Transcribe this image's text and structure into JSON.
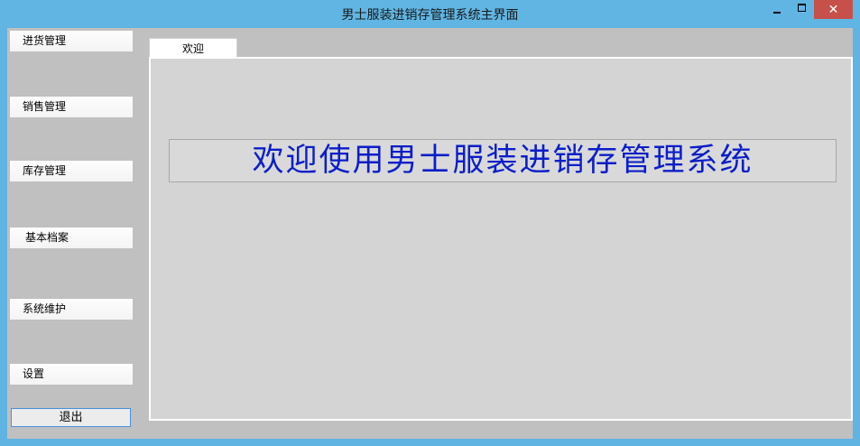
{
  "window": {
    "title": "男士服装进销存管理系统主界面",
    "close_glyph": "✕"
  },
  "sidebar": {
    "items": [
      {
        "label": "进货管理"
      },
      {
        "label": "销售管理"
      },
      {
        "label": "库存管理"
      },
      {
        "label": "基本档案"
      },
      {
        "label": "系统维护"
      },
      {
        "label": "设置"
      }
    ],
    "exit_label": "退出"
  },
  "tabs": [
    {
      "label": "欢迎"
    }
  ],
  "welcome": {
    "banner_text": "欢迎使用男士服装进销存管理系统"
  },
  "colors": {
    "title_bar": "#60b5e3",
    "close_button": "#c7504a",
    "banner_text": "#0b1ec9"
  }
}
